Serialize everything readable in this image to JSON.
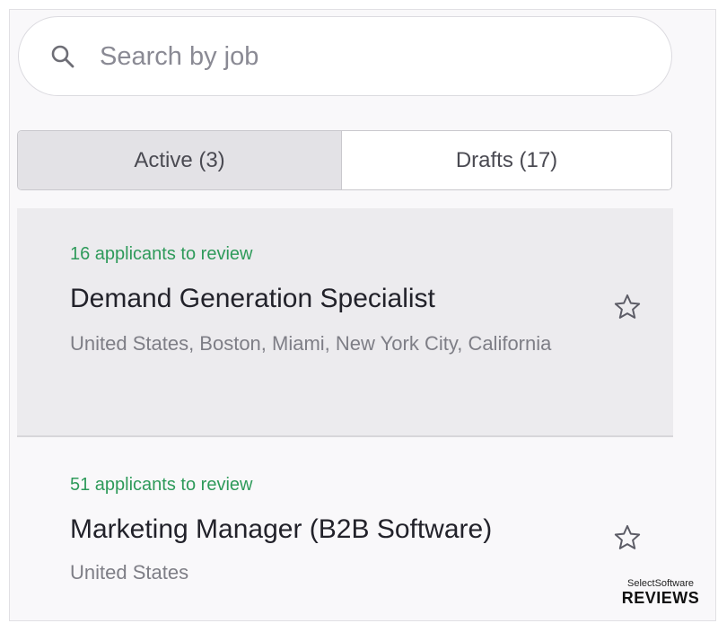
{
  "search": {
    "placeholder": "Search by job",
    "value": ""
  },
  "tabs": [
    {
      "label": "Active (3)",
      "selected": true
    },
    {
      "label": "Drafts (17)",
      "selected": false
    }
  ],
  "jobs": [
    {
      "applicants": "16 applicants to review",
      "title": "Demand Generation Specialist",
      "location": "United States, Boston, Miami, New York City, California",
      "starred": false,
      "selected": true
    },
    {
      "applicants": "51 applicants to review",
      "title": "Marketing Manager (B2B Software)",
      "location": "United States",
      "starred": false,
      "selected": false
    }
  ],
  "watermark": {
    "line1": "SelectSoftware",
    "line2": "REVIEWS"
  },
  "colors": {
    "applicants_green": "#2e9a5a",
    "selected_card_bg": "#ecebee",
    "panel_bg": "#f9f8fa"
  },
  "icons": {
    "search": "search-icon",
    "star": "star-outline-icon"
  }
}
